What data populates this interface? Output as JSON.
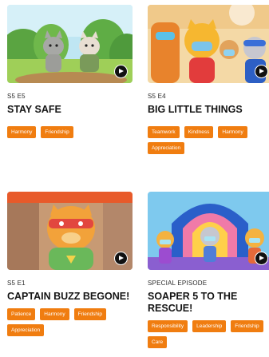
{
  "episodes": [
    {
      "label": "S5 E5",
      "title": "STAY SAFE",
      "tags": [
        "Harmony",
        "Friendship"
      ]
    },
    {
      "label": "S5 E4",
      "title": "BIG LITTLE THINGS",
      "tags": [
        "Teamwork",
        "Kindness",
        "Harmony",
        "Appreciation"
      ]
    },
    {
      "label": "S5 E1",
      "title": "CAPTAIN BUZZ BEGONE!",
      "tags": [
        "Patience",
        "Harmony",
        "Friendship",
        "Appreciation"
      ]
    },
    {
      "label": "SPECIAL EPISODE",
      "title": "SOAPER 5 TO THE RESCUE!",
      "tags": [
        "Responsibility",
        "Leadership",
        "Friendship",
        "Care"
      ]
    }
  ],
  "colors": {
    "tag_background": "#f07d10",
    "tag_text": "#ffffff",
    "title_text": "#151515",
    "play_button": "#111111"
  },
  "icons": {
    "play": "play-icon"
  }
}
